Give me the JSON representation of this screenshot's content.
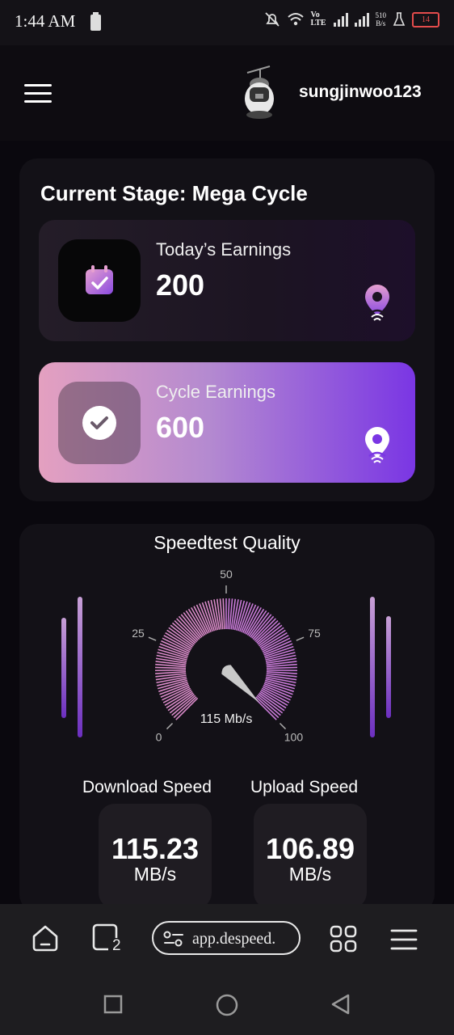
{
  "status_bar": {
    "time": "1:44 AM",
    "network": "Vo LTE",
    "net_speed_value": "510",
    "net_speed_unit": "B/s",
    "battery": "14",
    "battery_color": "#e54c4c"
  },
  "header": {
    "username": "sungjinwoo123"
  },
  "stage": {
    "title": "Current Stage: Mega Cycle"
  },
  "earnings": [
    {
      "label": "Today’s Earnings",
      "value": "200"
    },
    {
      "label": "Cycle Earnings",
      "value": "600"
    }
  ],
  "speedtest": {
    "title": "Speedtest Quality",
    "scale_labels": [
      "0",
      "25",
      "50",
      "75",
      "100"
    ],
    "gauge_value": 115,
    "gauge_readout": "115 Mb/s",
    "download_label": "Download Speed",
    "upload_label": "Upload Speed",
    "download_value": "115.23",
    "download_unit": "MB/s",
    "upload_value": "106.89",
    "upload_unit": "MB/s"
  },
  "browser": {
    "url": "app.despeed.",
    "tab_count": "2"
  },
  "colors": {
    "accent_purple": "#7a36e4",
    "accent_pink": "#e4a0c0",
    "gauge_pink": "#d98ac8"
  }
}
